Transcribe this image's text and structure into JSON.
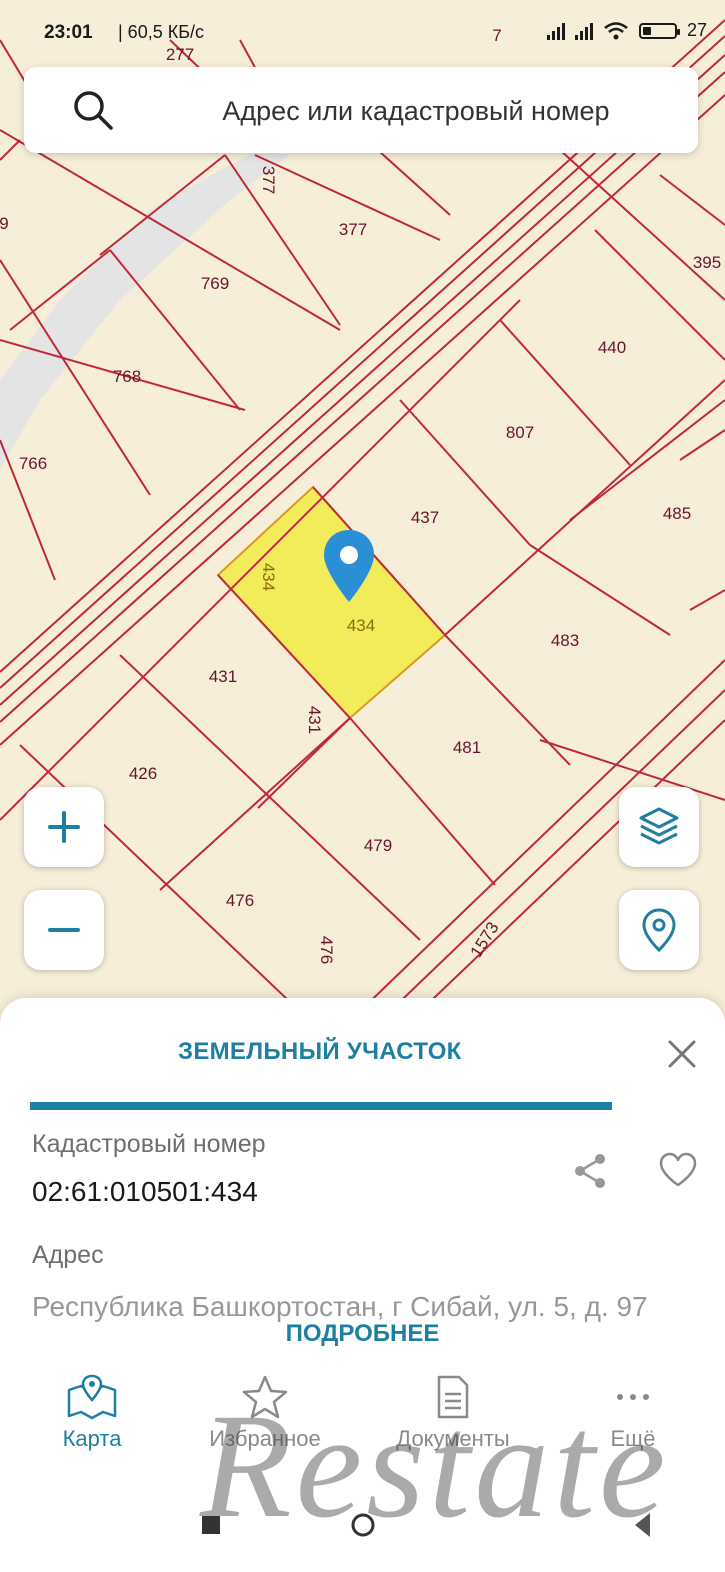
{
  "status_bar": {
    "time": "23:01",
    "speed": "| 60,5 КБ/с",
    "battery": "27",
    "battery_level": 0.27
  },
  "search": {
    "placeholder": "Адрес или кадастровый номер"
  },
  "map": {
    "plot_labels": [
      "277",
      "377",
      "377",
      "769",
      "768",
      "766",
      "395",
      "440",
      "807",
      "437",
      "485",
      "434",
      "434",
      "483",
      "431",
      "431",
      "481",
      "426",
      "479",
      "476",
      "476",
      "1573",
      "9",
      "7"
    ],
    "selected_plot": "434"
  },
  "sheet": {
    "title": "ЗЕМЕЛЬНЫЙ УЧАСТОК",
    "cadastral_label": "Кадастровый номер",
    "cadastral_value": "02:61:010501:434",
    "address_label": "Адрес",
    "address_value": "Республика Башкортостан, г Сибай, ул. 5, д. 97",
    "more_button": "ПОДРОБНЕЕ"
  },
  "nav": {
    "items": [
      {
        "label": "Карта",
        "icon": "map-icon",
        "active": true
      },
      {
        "label": "Избранное",
        "icon": "star-icon",
        "active": false
      },
      {
        "label": "Документы",
        "icon": "document-icon",
        "active": false
      },
      {
        "label": "Ещё",
        "icon": "more-icon",
        "active": false
      }
    ]
  },
  "watermark": "Restate",
  "colors": {
    "accent": "#1f7fa0",
    "parcel_line": "#c0283a",
    "selected_fill": "#f3ec5a",
    "map_bg": "#f6eed8"
  }
}
